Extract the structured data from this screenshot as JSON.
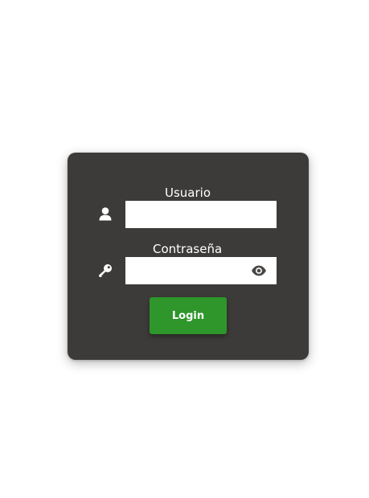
{
  "login_form": {
    "username": {
      "label": "Usuario",
      "value": "",
      "icon": "user-icon"
    },
    "password": {
      "label": "Contraseña",
      "value": "",
      "icon": "key-icon",
      "toggle_icon": "eye-icon"
    },
    "submit_label": "Login"
  },
  "colors": {
    "page_background": "#ffffff",
    "card_background": "#3d3b39",
    "label_text": "#ffffff",
    "input_background": "#ffffff",
    "button_background": "#2e962a",
    "button_text": "#ffffff",
    "eye_icon": "#4a4745"
  }
}
